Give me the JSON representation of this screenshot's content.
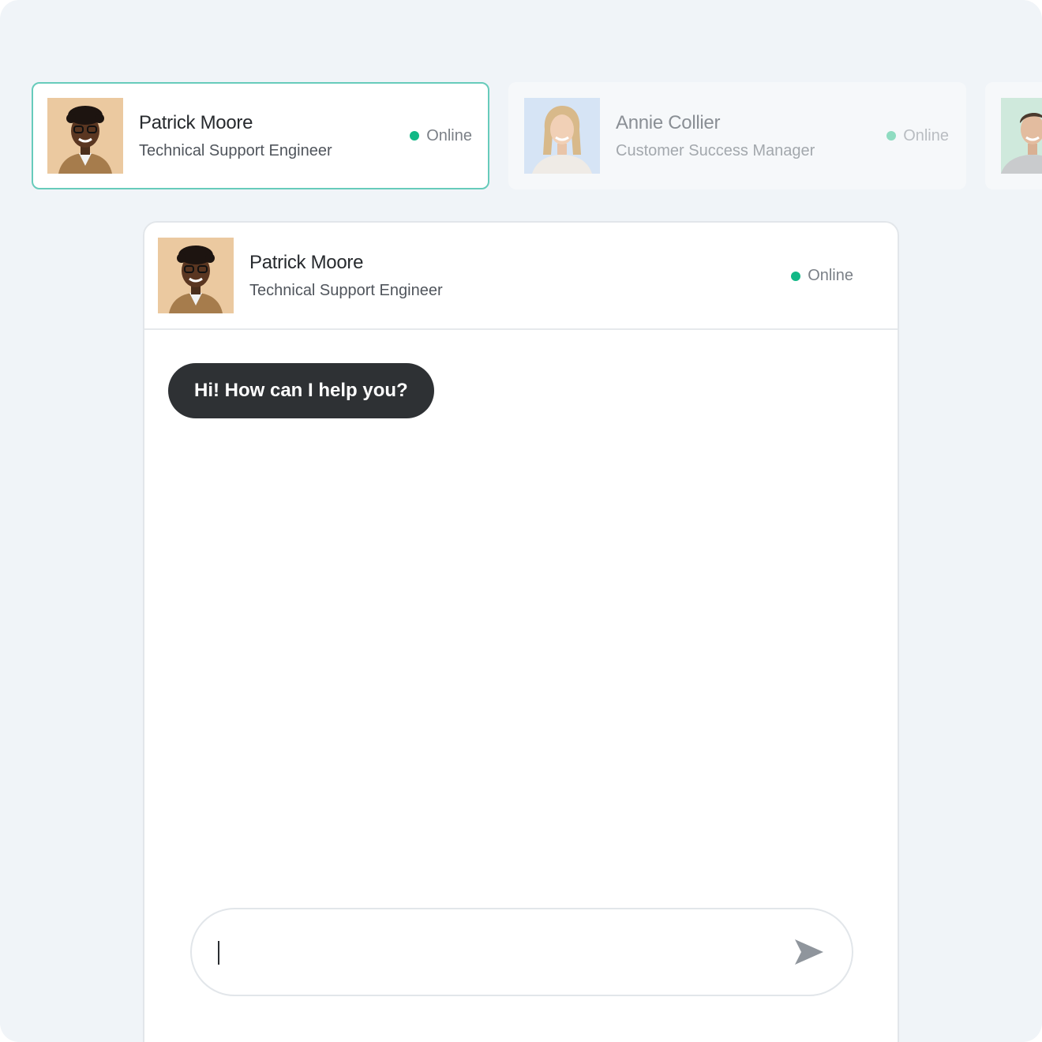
{
  "agents": [
    {
      "name": "Patrick Moore",
      "role": "Technical Support Engineer",
      "status": "Online",
      "avatar_bg": "#ebc9a0",
      "selected": true
    },
    {
      "name": "Annie Collier",
      "role": "Customer Success Manager",
      "status": "Online",
      "avatar_bg": "#d6e4f5",
      "selected": false
    },
    {
      "name": "",
      "role": "",
      "status": "",
      "avatar_bg": "#cfe9dc",
      "selected": false
    }
  ],
  "chat": {
    "agent": {
      "name": "Patrick Moore",
      "role": "Technical Support Engineer",
      "status": "Online"
    },
    "messages": [
      {
        "from": "agent",
        "text": "Hi! How can I help you?"
      }
    ],
    "composer": {
      "value": "",
      "placeholder": "",
      "send_icon": "send-icon"
    }
  },
  "colors": {
    "online": "#12b886",
    "active_border": "#67cbbb",
    "bubble": "#2e3134",
    "background": "#f0f4f8"
  }
}
